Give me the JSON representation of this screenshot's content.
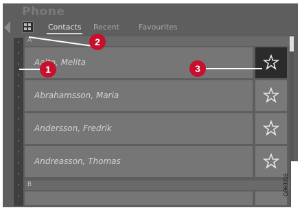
{
  "screen": {
    "title": "Phone"
  },
  "tabs": [
    {
      "label": "Contacts",
      "active": true
    },
    {
      "label": "Recent",
      "active": false
    },
    {
      "label": "Favourites",
      "active": false
    }
  ],
  "sections": [
    {
      "letter": "A"
    },
    {
      "letter": "B"
    }
  ],
  "contacts": [
    {
      "name": "Aalto, Melita",
      "favourite_selected": true
    },
    {
      "name": "Abrahamsson, Maria",
      "favourite_selected": false
    },
    {
      "name": "Andersson, Fredrik",
      "favourite_selected": false
    },
    {
      "name": "Andreasson, Thomas",
      "favourite_selected": false
    }
  ],
  "callouts": [
    "1",
    "2",
    "3"
  ],
  "image_id": "G063316",
  "colors": {
    "callout": "#c8102e",
    "selected_star_bg": "#2b2b2b"
  }
}
